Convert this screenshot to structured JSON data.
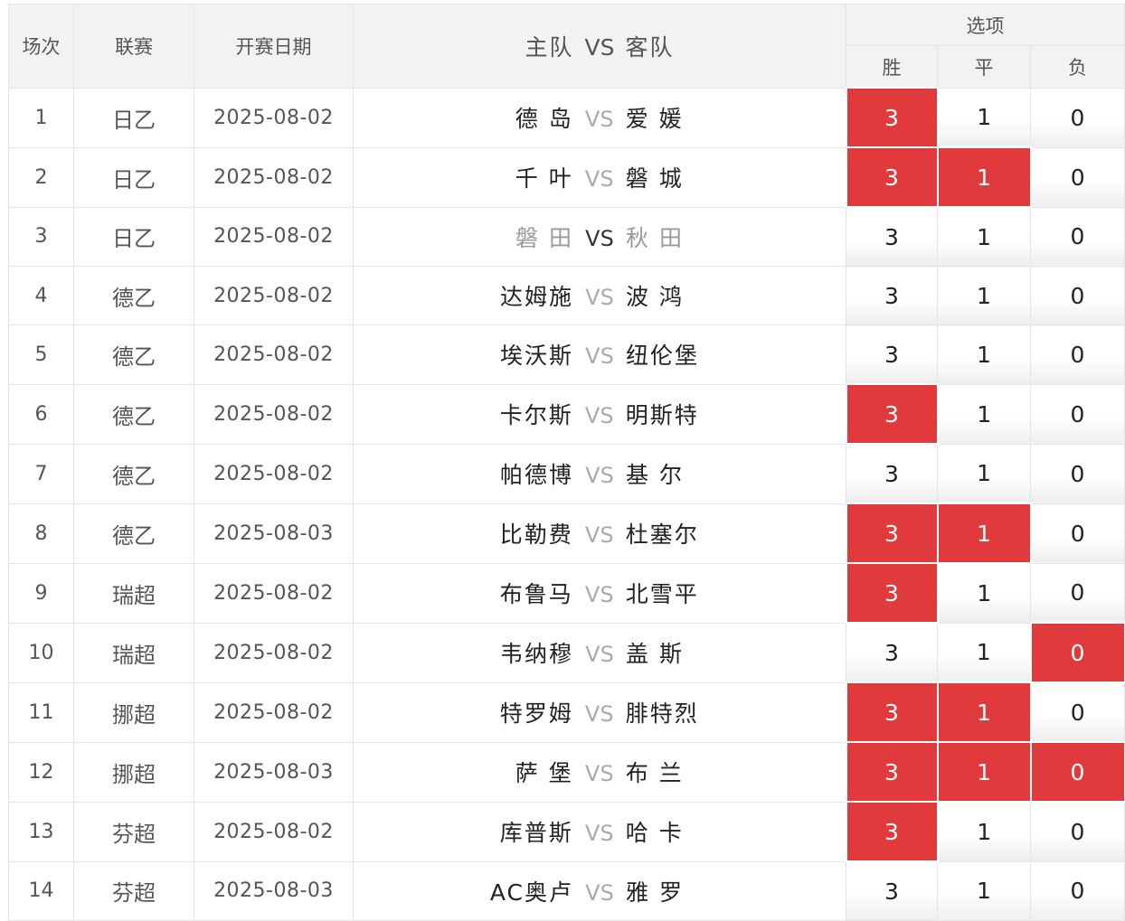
{
  "header": {
    "no": "场次",
    "league": "联赛",
    "date": "开赛日期",
    "home": "主队",
    "vs": "VS",
    "away": "客队",
    "options": "选项",
    "win": "胜",
    "draw": "平",
    "lose": "负"
  },
  "colors": {
    "selected": "#e13a3d",
    "header_bg": "#f2f2f2",
    "border": "#e4e4e4"
  },
  "rows": [
    {
      "no": "1",
      "league": "日乙",
      "date": "2025-08-02",
      "home": "德 岛",
      "vs": "VS",
      "away": "爱 媛",
      "dim": false,
      "win": "3",
      "draw": "1",
      "lose": "0",
      "sel": [
        true,
        false,
        false
      ]
    },
    {
      "no": "2",
      "league": "日乙",
      "date": "2025-08-02",
      "home": "千 叶",
      "vs": "VS",
      "away": "磐 城",
      "dim": false,
      "win": "3",
      "draw": "1",
      "lose": "0",
      "sel": [
        true,
        true,
        false
      ]
    },
    {
      "no": "3",
      "league": "日乙",
      "date": "2025-08-02",
      "home": "磐 田",
      "vs": "VS",
      "away": "秋 田",
      "dim": true,
      "win": "3",
      "draw": "1",
      "lose": "0",
      "sel": [
        false,
        false,
        false
      ]
    },
    {
      "no": "4",
      "league": "德乙",
      "date": "2025-08-02",
      "home": "达姆施",
      "vs": "VS",
      "away": "波 鸿",
      "dim": false,
      "win": "3",
      "draw": "1",
      "lose": "0",
      "sel": [
        false,
        false,
        false
      ]
    },
    {
      "no": "5",
      "league": "德乙",
      "date": "2025-08-02",
      "home": "埃沃斯",
      "vs": "VS",
      "away": "纽伦堡",
      "dim": false,
      "win": "3",
      "draw": "1",
      "lose": "0",
      "sel": [
        false,
        false,
        false
      ]
    },
    {
      "no": "6",
      "league": "德乙",
      "date": "2025-08-02",
      "home": "卡尔斯",
      "vs": "VS",
      "away": "明斯特",
      "dim": false,
      "win": "3",
      "draw": "1",
      "lose": "0",
      "sel": [
        true,
        false,
        false
      ]
    },
    {
      "no": "7",
      "league": "德乙",
      "date": "2025-08-02",
      "home": "帕德博",
      "vs": "VS",
      "away": "基 尔",
      "dim": false,
      "win": "3",
      "draw": "1",
      "lose": "0",
      "sel": [
        false,
        false,
        false
      ]
    },
    {
      "no": "8",
      "league": "德乙",
      "date": "2025-08-03",
      "home": "比勒费",
      "vs": "VS",
      "away": "杜塞尔",
      "dim": false,
      "win": "3",
      "draw": "1",
      "lose": "0",
      "sel": [
        true,
        true,
        false
      ]
    },
    {
      "no": "9",
      "league": "瑞超",
      "date": "2025-08-02",
      "home": "布鲁马",
      "vs": "VS",
      "away": "北雪平",
      "dim": false,
      "win": "3",
      "draw": "1",
      "lose": "0",
      "sel": [
        true,
        false,
        false
      ]
    },
    {
      "no": "10",
      "league": "瑞超",
      "date": "2025-08-02",
      "home": "韦纳穆",
      "vs": "VS",
      "away": "盖 斯",
      "dim": false,
      "win": "3",
      "draw": "1",
      "lose": "0",
      "sel": [
        false,
        false,
        true
      ]
    },
    {
      "no": "11",
      "league": "挪超",
      "date": "2025-08-02",
      "home": "特罗姆",
      "vs": "VS",
      "away": "腓特烈",
      "dim": false,
      "win": "3",
      "draw": "1",
      "lose": "0",
      "sel": [
        true,
        true,
        false
      ]
    },
    {
      "no": "12",
      "league": "挪超",
      "date": "2025-08-03",
      "home": "萨 堡",
      "vs": "VS",
      "away": "布 兰",
      "dim": false,
      "win": "3",
      "draw": "1",
      "lose": "0",
      "sel": [
        true,
        true,
        true
      ]
    },
    {
      "no": "13",
      "league": "芬超",
      "date": "2025-08-02",
      "home": "库普斯",
      "vs": "VS",
      "away": "哈 卡",
      "dim": false,
      "win": "3",
      "draw": "1",
      "lose": "0",
      "sel": [
        true,
        false,
        false
      ]
    },
    {
      "no": "14",
      "league": "芬超",
      "date": "2025-08-03",
      "home": "AC奥卢",
      "vs": "VS",
      "away": "雅 罗",
      "dim": false,
      "win": "3",
      "draw": "1",
      "lose": "0",
      "sel": [
        false,
        false,
        false
      ]
    }
  ]
}
